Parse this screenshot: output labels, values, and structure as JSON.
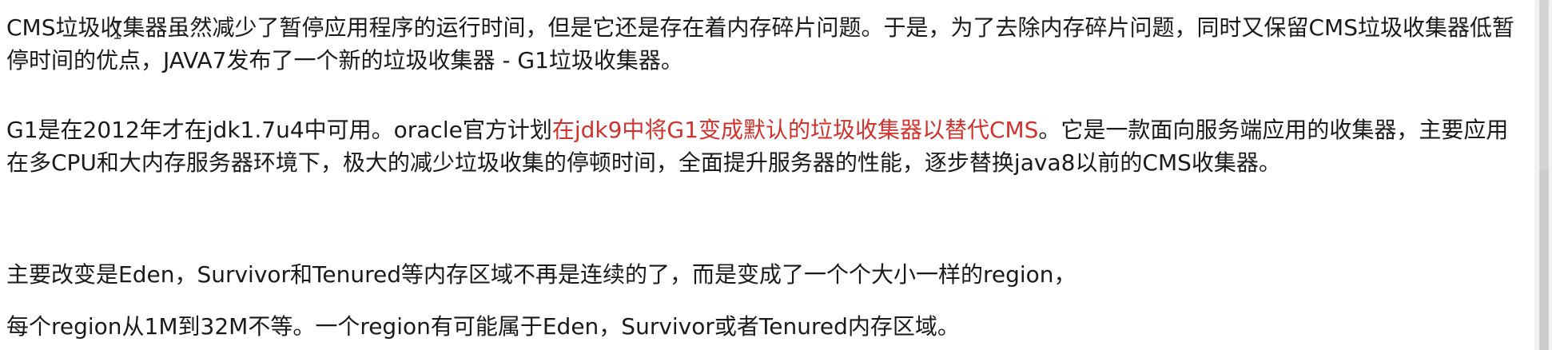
{
  "article": {
    "para1": "CMS垃圾收集器虽然减少了暂停应用程序的运行时间，但是它还是存在着内存碎片问题。于是，为了去除内存碎片问题，同时又保留CMS垃圾收集器低暂停时间的优点，JAVA7发布了一个新的垃圾收集器 - G1垃圾收集器。",
    "para2_before": "G1是在2012年才在jdk1.7u4中可用。oracle官方计划",
    "para2_highlight": "在jdk9中将G1变成默认的垃圾收集器以替代CMS",
    "para2_after": "。它是一款面向服务端应用的收集器，主要应用在多CPU和大内存服务器环境下，极大的减少垃圾收集的停顿时间，全面提升服务器的性能，逐步替换java8以前的CMS收集器。",
    "para3": "主要改变是Eden，Survivor和Tenured等内存区域不再是连续的了，而是变成了一个个大小一样的region，",
    "para4": "每个region从1M到32M不等。一个region有可能属于Eden，Survivor或者Tenured内存区域。"
  },
  "colors": {
    "highlight": "#d0332d",
    "text": "#1a1a1a"
  },
  "icons": {
    "cursor": "text-cursor-icon"
  }
}
